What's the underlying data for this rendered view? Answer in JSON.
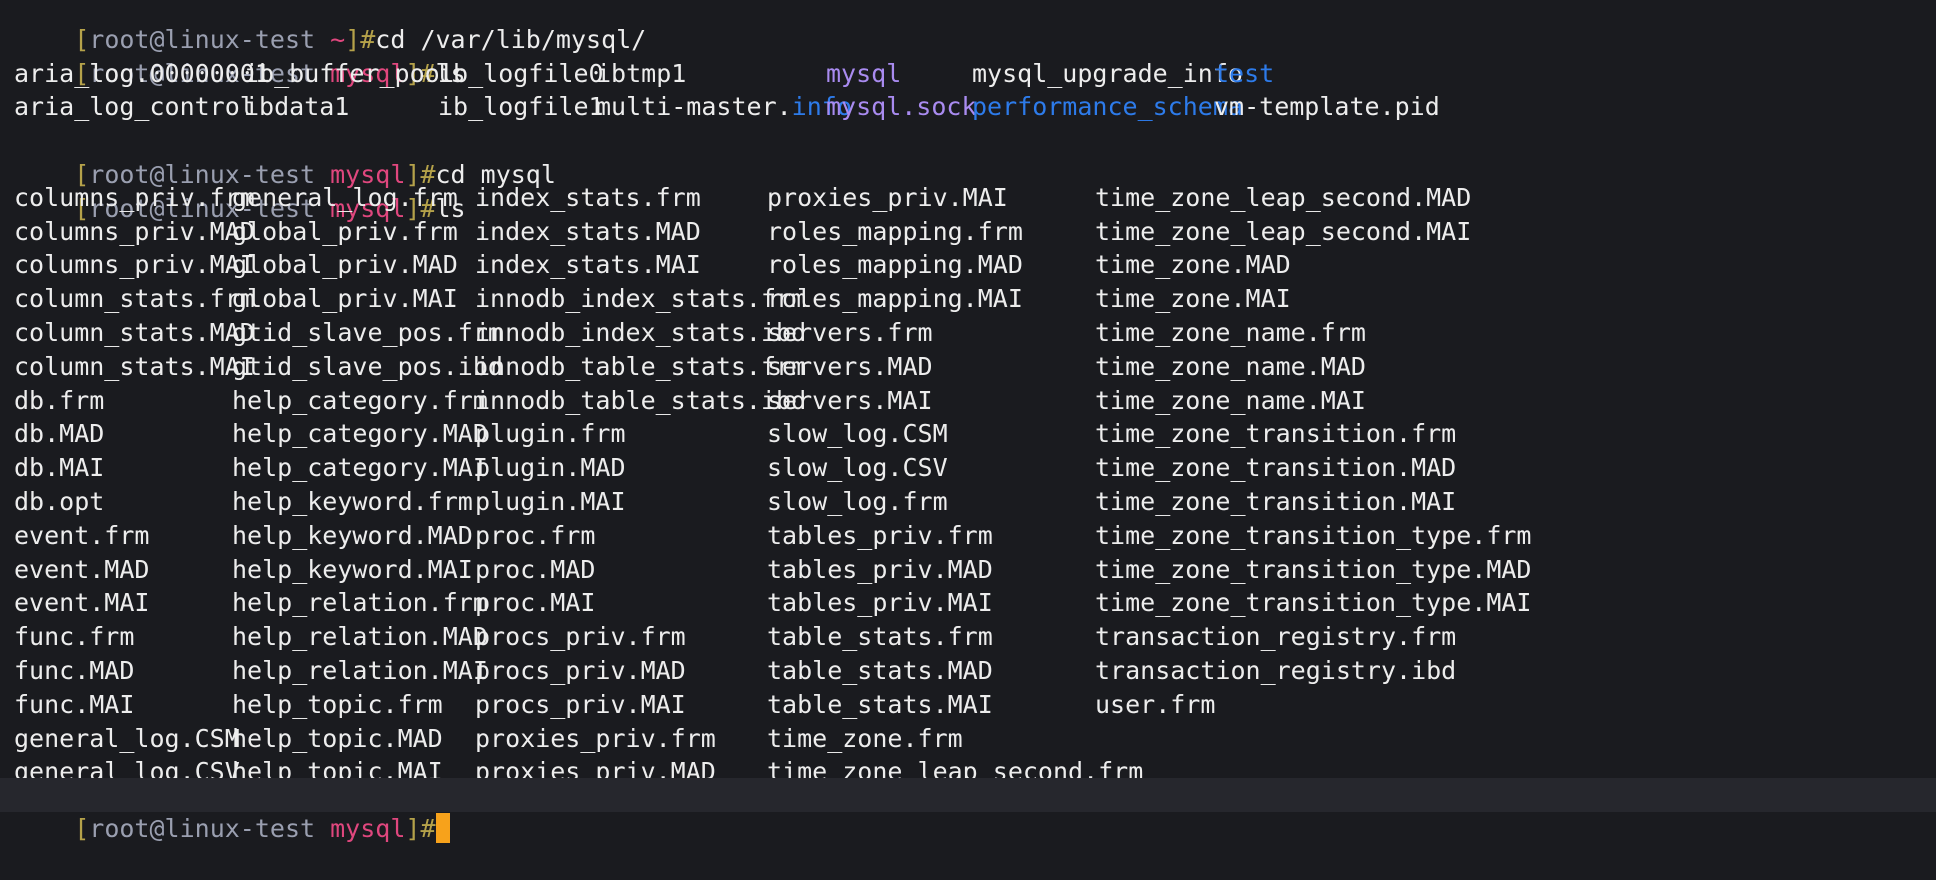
{
  "prompt": {
    "open": "[",
    "user_host": "root@linux-test",
    "close": "]#"
  },
  "history": [
    {
      "dir": "~",
      "cmd": "cd /var/lib/mysql/"
    },
    {
      "dir": "mysql",
      "cmd": "ls"
    },
    {
      "dir": "mysql",
      "cmd": "cd mysql"
    },
    {
      "dir": "mysql",
      "cmd": "ls"
    }
  ],
  "ls_var_lib_mysql": {
    "rows": [
      [
        "aria_log.00000001",
        "ib_buffer_pool",
        "ib_logfile0",
        "ibtmp1",
        "mysql",
        "mysql_upgrade_info",
        "test"
      ],
      [
        "aria_log_control",
        "ibdata1",
        "ib_logfile1",
        "multi-master.info",
        "mysql.sock",
        "performance_schema",
        "vm-template.pid"
      ]
    ]
  },
  "ls_mysql": {
    "columns": [
      [
        "columns_priv.frm",
        "columns_priv.MAD",
        "columns_priv.MAI",
        "column_stats.frm",
        "column_stats.MAD",
        "column_stats.MAI",
        "db.frm",
        "db.MAD",
        "db.MAI",
        "db.opt",
        "event.frm",
        "event.MAD",
        "event.MAI",
        "func.frm",
        "func.MAD",
        "func.MAI",
        "general_log.CSM",
        "general_log.CSV"
      ],
      [
        "general_log.frm",
        "global_priv.frm",
        "global_priv.MAD",
        "global_priv.MAI",
        "gtid_slave_pos.frm",
        "gtid_slave_pos.ibd",
        "help_category.frm",
        "help_category.MAD",
        "help_category.MAI",
        "help_keyword.frm",
        "help_keyword.MAD",
        "help_keyword.MAI",
        "help_relation.frm",
        "help_relation.MAD",
        "help_relation.MAI",
        "help_topic.frm",
        "help_topic.MAD",
        "help_topic.MAI"
      ],
      [
        "index_stats.frm",
        "index_stats.MAD",
        "index_stats.MAI",
        "innodb_index_stats.frm",
        "innodb_index_stats.ibd",
        "innodb_table_stats.frm",
        "innodb_table_stats.ibd",
        "plugin.frm",
        "plugin.MAD",
        "plugin.MAI",
        "proc.frm",
        "proc.MAD",
        "proc.MAI",
        "procs_priv.frm",
        "procs_priv.MAD",
        "procs_priv.MAI",
        "proxies_priv.frm",
        "proxies_priv.MAD"
      ],
      [
        "proxies_priv.MAI",
        "roles_mapping.frm",
        "roles_mapping.MAD",
        "roles_mapping.MAI",
        "servers.frm",
        "servers.MAD",
        "servers.MAI",
        "slow_log.CSM",
        "slow_log.CSV",
        "slow_log.frm",
        "tables_priv.frm",
        "tables_priv.MAD",
        "tables_priv.MAI",
        "table_stats.frm",
        "table_stats.MAD",
        "table_stats.MAI",
        "time_zone.frm",
        "time_zone_leap_second.frm"
      ],
      [
        "time_zone_leap_second.MAD",
        "time_zone_leap_second.MAI",
        "time_zone.MAD",
        "time_zone.MAI",
        "time_zone_name.frm",
        "time_zone_name.MAD",
        "time_zone_name.MAI",
        "time_zone_transition.frm",
        "time_zone_transition.MAD",
        "time_zone_transition.MAI",
        "time_zone_transition_type.frm",
        "time_zone_transition_type.MAD",
        "time_zone_transition_type.MAI",
        "transaction_registry.frm",
        "transaction_registry.ibd",
        "user.frm"
      ]
    ]
  },
  "current": {
    "dir": "mysql"
  },
  "colors": {
    "background": "#1a1b1f",
    "bracket": "#b5a24a",
    "user_host": "#9a9fb0",
    "prompt_dir": "#e0477e",
    "directory": "#2d7bea",
    "socket": "#a98bf0",
    "cursor": "#f7a21b"
  }
}
